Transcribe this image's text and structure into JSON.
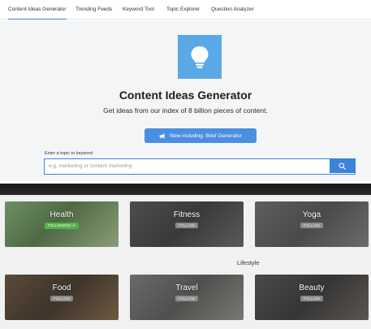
{
  "nav": {
    "tabs": [
      {
        "label": "Content Ideas Generator",
        "active": true
      },
      {
        "label": "Trending Feeds"
      },
      {
        "label": "Keyword Tool"
      },
      {
        "label": "Topic Explorer"
      },
      {
        "label": "Question Analyzer"
      }
    ]
  },
  "hero": {
    "icon": "lightbulb-icon",
    "title": "Content Ideas Generator",
    "subtitle": "Get ideas from our index of 8 billion pieces of content.",
    "promo_label": "Now including: Brief Generator",
    "topic_label": "Enter a topic or keyword",
    "search_placeholder": "e.g. marketing or content marketing"
  },
  "topics": {
    "cards": [
      {
        "title": "Health",
        "badge": "FOLLOWING ✔",
        "following": true
      },
      {
        "title": "Fitness",
        "badge": "FOLLOW",
        "following": false
      },
      {
        "title": "Yoga",
        "badge": "FOLLOW",
        "following": false
      },
      {
        "title": "Food",
        "badge": "FOLLOW",
        "following": false
      },
      {
        "title": "Travel",
        "badge": "FOLLOW",
        "following": false
      },
      {
        "title": "Beauty",
        "badge": "FOLLOW",
        "following": false
      }
    ],
    "section_label": "Lifestyle"
  },
  "colors": {
    "accent": "#3b84d8",
    "logo_bg": "#5aa9e6",
    "following_badge": "#55b24a"
  }
}
